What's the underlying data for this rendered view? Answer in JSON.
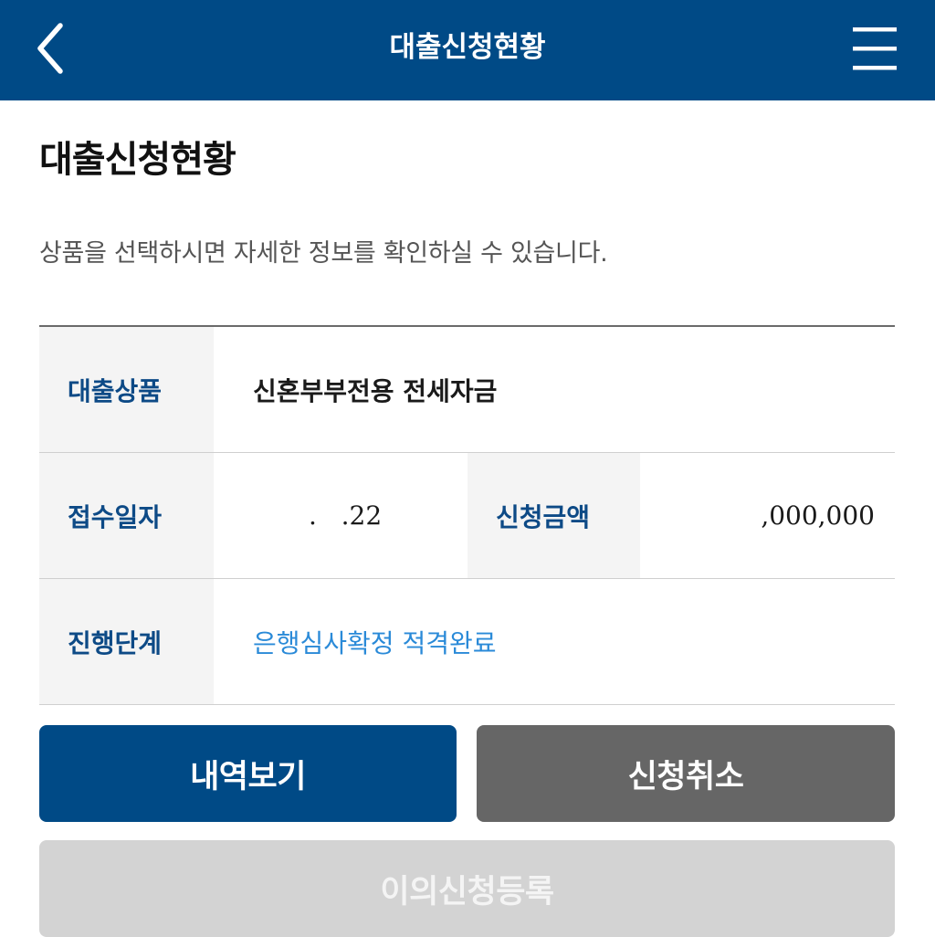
{
  "header": {
    "back_icon": "chevron-left-icon",
    "title": "대출신청현황",
    "menu_icon": "hamburger-menu-icon",
    "background_color": "#004a86"
  },
  "main": {
    "title": "대출신청현황",
    "description": "상품을 선택하시면 자세한 정보를 확인하실 수 있습니다."
  },
  "info": {
    "product_label": "대출상품",
    "product_value": "신혼부부전용 전세자금",
    "date_label": "접수일자",
    "date_value": ".   .22",
    "amount_label": "신청금액",
    "amount_value": ",000,000",
    "stage_label": "진행단계",
    "stage_value": "은행심사확정 적격완료"
  },
  "buttons": {
    "view_history": "내역보기",
    "cancel_application": "신청취소",
    "register_objection": "이의신청등록"
  },
  "colors": {
    "primary": "#004a86",
    "label_text": "#0d4a86",
    "link_text": "#2a8ad8",
    "secondary_button": "#666666",
    "disabled_button": "#d3d3d3"
  }
}
